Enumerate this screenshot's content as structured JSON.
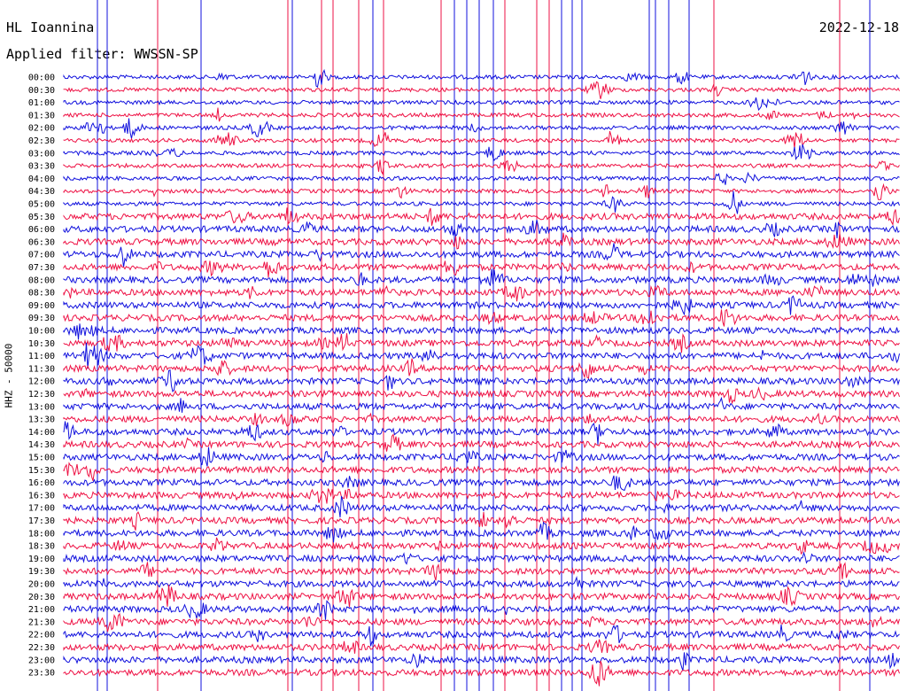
{
  "header": {
    "station": "HL Ioannina",
    "filter": "Applied filter: WWSSN-SP",
    "date": "2022-12-18"
  },
  "chart_data": {
    "type": "line",
    "ylabel": "HHZ - 50000",
    "row_labels": [
      "00:00",
      "00:30",
      "01:00",
      "01:30",
      "02:00",
      "02:30",
      "03:00",
      "03:30",
      "04:00",
      "04:30",
      "05:00",
      "05:30",
      "06:00",
      "06:30",
      "07:00",
      "07:30",
      "08:00",
      "08:30",
      "09:00",
      "09:30",
      "10:00",
      "10:30",
      "11:00",
      "11:30",
      "12:00",
      "12:30",
      "13:00",
      "13:30",
      "14:00",
      "14:30",
      "15:00",
      "15:30",
      "16:00",
      "16:30",
      "17:00",
      "17:30",
      "18:00",
      "18:30",
      "19:00",
      "19:30",
      "20:00",
      "20:30",
      "21:00",
      "21:30",
      "22:00",
      "22:30",
      "23:00",
      "23:30"
    ],
    "series_colors": [
      "#1010dd",
      "#ee1144"
    ],
    "grid": false
  }
}
